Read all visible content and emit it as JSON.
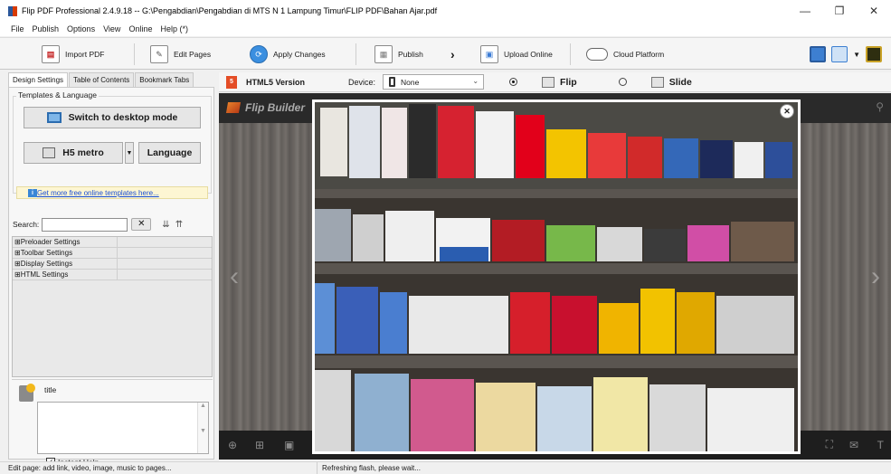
{
  "window": {
    "title": "Flip PDF Professional 2.4.9.18 -- G:\\Pengabdian\\Pengabdian di  MTS N 1 Lampung Timur\\FLIP PDF\\Bahan Ajar.pdf",
    "min": "—",
    "max": "❐",
    "close": "✕"
  },
  "menu": [
    "File",
    "Publish",
    "Options",
    "View",
    "Online",
    "Help (*)"
  ],
  "toolbar": {
    "import_pdf": "Import PDF",
    "edit_pages": "Edit Pages",
    "apply_changes": "Apply Changes",
    "publish": "Publish",
    "upload_online": "Upload Online",
    "cloud_platform": "Cloud Platform"
  },
  "left": {
    "tabs": [
      "Design Settings",
      "Table of Contents",
      "Bookmark Tabs"
    ],
    "group_label": "Templates & Language",
    "switch_desktop": "Switch to desktop mode",
    "template_name": "H5 metro",
    "language": "Language",
    "more_templates": "Get more free online templates here...",
    "search_label": "Search:",
    "settings": [
      "⊞Preloader Settings",
      "⊞Toolbar Settings",
      "⊞Display Settings",
      "⊞HTML Settings"
    ],
    "help_title": "title",
    "instant_help": "Instant Help"
  },
  "preview": {
    "html5_label": "HTML5 Version",
    "device_label": "Device:",
    "device_value": "None",
    "flip_label": "Flip",
    "slide_label": "Slide",
    "stage_logo": "Flip Builder"
  },
  "status": {
    "left": "Edit page: add link, video, image, music to pages...",
    "middle": "Refreshing flash, please wait..."
  },
  "photo": {
    "shelf_colors": [
      "#3a3530",
      "#4b4a45"
    ],
    "accent": "#e2001a"
  }
}
